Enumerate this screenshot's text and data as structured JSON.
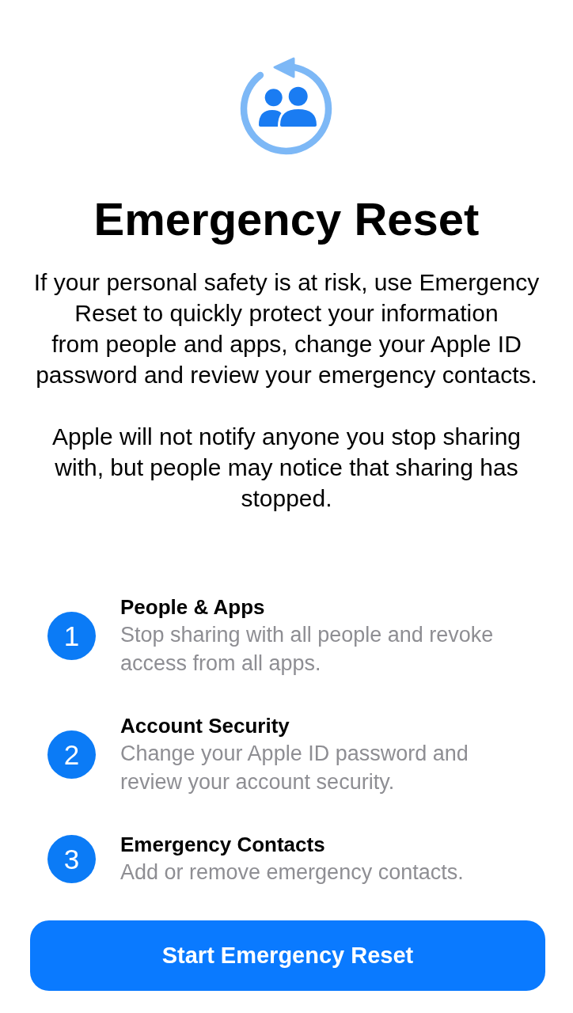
{
  "header": {
    "title": "Emergency Reset",
    "paragraphs": [
      "If your personal safety is at risk, use Emergency\nReset to quickly protect your information\nfrom people and apps, change your Apple ID\npassword and review your emergency contacts.",
      "Apple will not notify anyone you stop sharing\nwith, but people may notice that sharing has\nstopped."
    ]
  },
  "steps": [
    {
      "number": "1",
      "title": "People & Apps",
      "description": "Stop sharing with all people and revoke access from all apps."
    },
    {
      "number": "2",
      "title": "Account Security",
      "description": "Change your Apple ID password and review your account security."
    },
    {
      "number": "3",
      "title": "Emergency Contacts",
      "description": "Add or remove emergency contacts."
    }
  ],
  "primary_button": {
    "label": "Start Emergency Reset"
  }
}
